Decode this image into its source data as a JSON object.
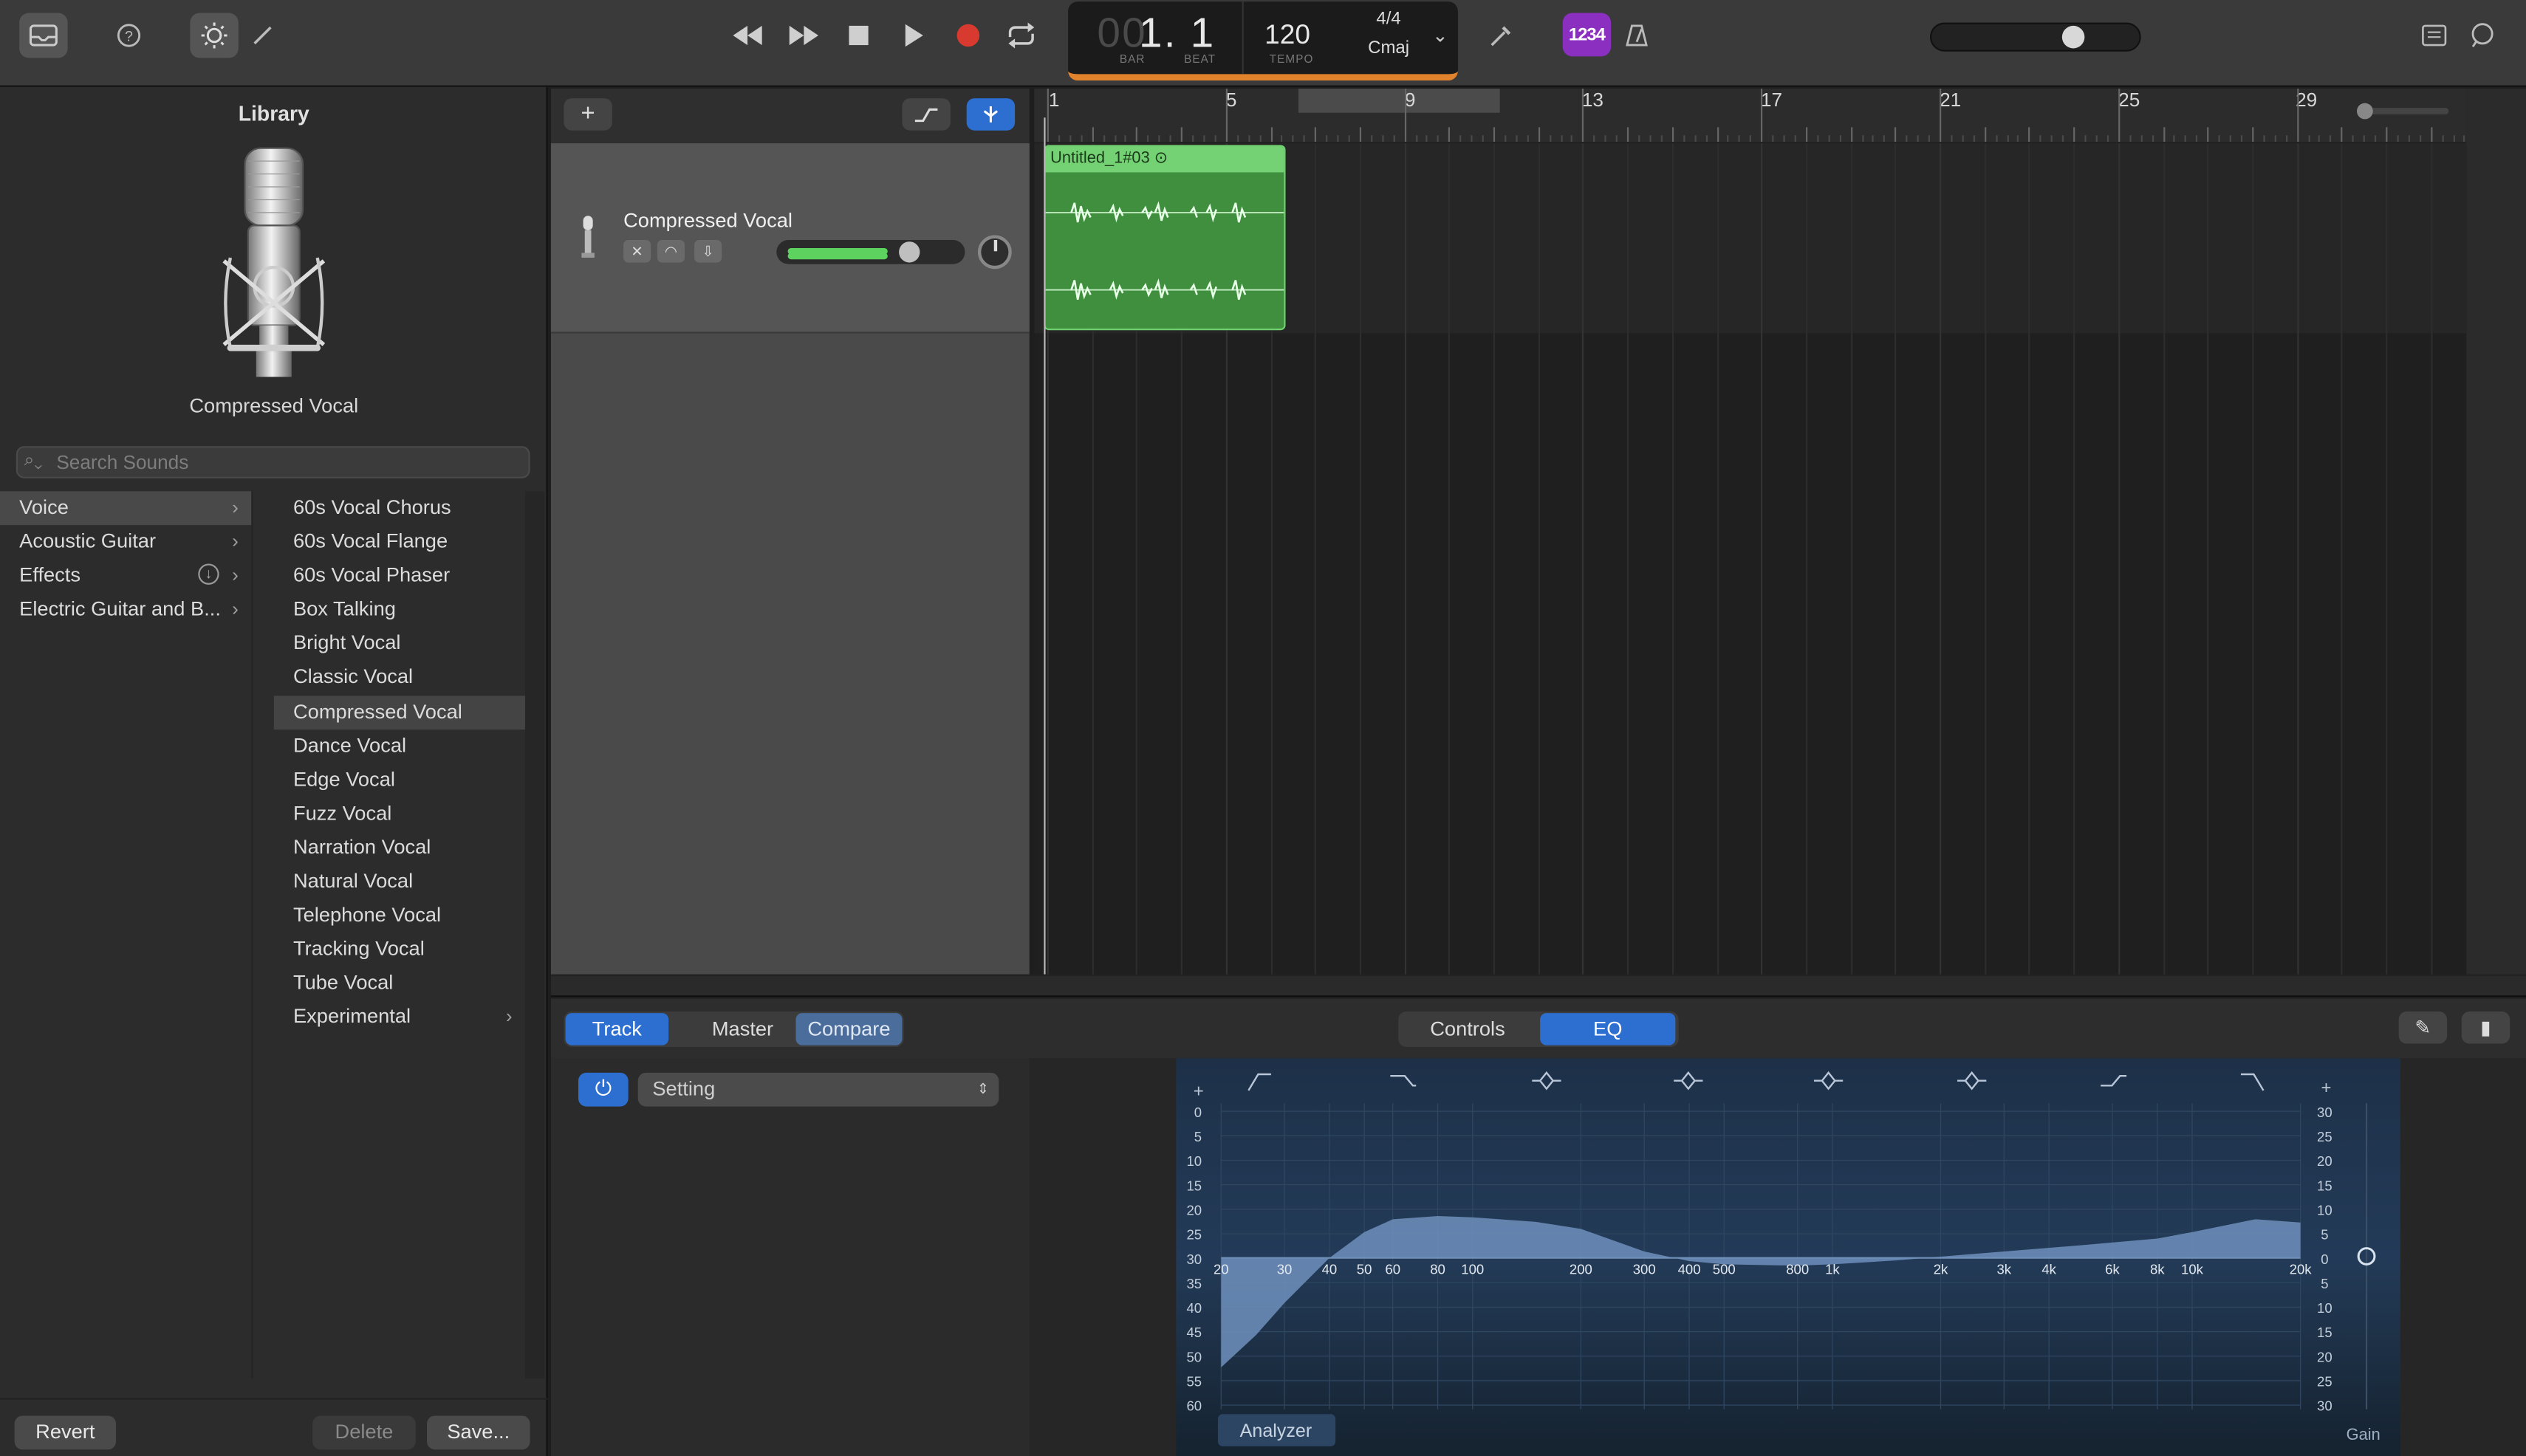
{
  "toolbar": {
    "lcd": {
      "bar_dim": "00",
      "position": "1. 1",
      "bar_label": "BAR",
      "beat_label": "BEAT",
      "tempo": "120",
      "tempo_label": "TEMPO",
      "time_signature": "4/4",
      "key": "Cmaj"
    },
    "count_in": "1234"
  },
  "library": {
    "title": "Library",
    "patch_name": "Compressed Vocal",
    "search_placeholder": "Search Sounds",
    "categories": [
      "Voice",
      "Acoustic Guitar",
      "Effects",
      "Electric Guitar and B..."
    ],
    "patches": [
      "60s Vocal Chorus",
      "60s Vocal Flange",
      "60s Vocal Phaser",
      "Box Talking",
      "Bright Vocal",
      "Classic Vocal",
      "Compressed Vocal",
      "Dance Vocal",
      "Edge Vocal",
      "Fuzz Vocal",
      "Narration Vocal",
      "Natural Vocal",
      "Telephone Vocal",
      "Tracking Vocal",
      "Tube Vocal",
      "Experimental"
    ],
    "selected_category": "Voice",
    "selected_patch": "Compressed Vocal",
    "buttons": {
      "revert": "Revert",
      "delete": "Delete",
      "save": "Save..."
    }
  },
  "tracks": {
    "add_label": "+",
    "items": [
      {
        "name": "Compressed Vocal"
      }
    ],
    "region_name": "Untitled_1#03"
  },
  "ruler": {
    "bars": [
      "1",
      "5",
      "9",
      "13",
      "17",
      "21",
      "25",
      "29"
    ]
  },
  "smart_controls": {
    "tabs": [
      "Track",
      "Master",
      "Compare"
    ],
    "view_tabs": [
      "Controls",
      "EQ"
    ],
    "active_view": "EQ",
    "setting_label": "Setting",
    "eq": {
      "db_left": [
        "0",
        "5",
        "10",
        "15",
        "20",
        "25",
        "30",
        "35",
        "40",
        "45",
        "50",
        "55",
        "60"
      ],
      "db_right": [
        "30",
        "25",
        "20",
        "15",
        "10",
        "5",
        "0",
        "5",
        "10",
        "15",
        "20",
        "25",
        "30"
      ],
      "freqs": [
        "20",
        "30",
        "40",
        "50",
        "60",
        "80",
        "100",
        "200",
        "300",
        "400",
        "500",
        "800",
        "1k",
        "2k",
        "3k",
        "4k",
        "6k",
        "8k",
        "10k",
        "20k"
      ],
      "analyzer_label": "Analyzer",
      "gain_label": "Gain",
      "plus_label": "+"
    }
  },
  "colors": {
    "accent": "#2d6fd0",
    "region": "#3f8f3f",
    "record": "#d93a2f",
    "lcd_accent": "#e0832c"
  }
}
